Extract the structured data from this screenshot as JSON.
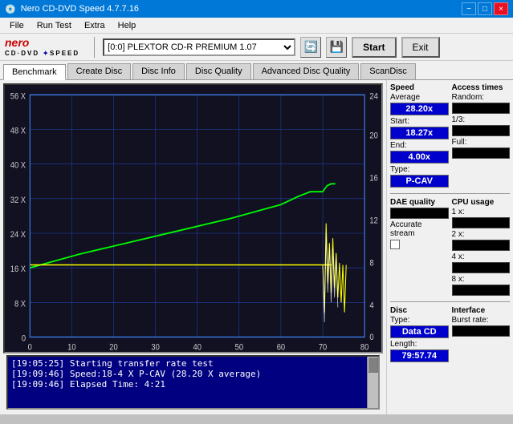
{
  "titleBar": {
    "title": "Nero CD-DVD Speed 4.7.7.16",
    "minimizeLabel": "−",
    "maximizeLabel": "□",
    "closeLabel": "×"
  },
  "menu": {
    "items": [
      "File",
      "Run Test",
      "Extra",
      "Help"
    ]
  },
  "toolbar": {
    "driveValue": "[0:0]  PLEXTOR CD-R  PREMIUM 1.07",
    "startLabel": "Start",
    "exitLabel": "Exit"
  },
  "tabs": {
    "items": [
      "Benchmark",
      "Create Disc",
      "Disc Info",
      "Disc Quality",
      "Advanced Disc Quality",
      "ScanDisc"
    ],
    "active": 0
  },
  "speedPanel": {
    "speedLabel": "Speed",
    "averageLabel": "Average",
    "averageValue": "28.20x",
    "startLabel": "Start:",
    "startValue": "18.27x",
    "endLabel": "End:",
    "endValue": "4.00x",
    "typeLabel": "Type:",
    "typeValue": "P-CAV"
  },
  "accessPanel": {
    "title": "Access times",
    "randomLabel": "Random:",
    "oneThirdLabel": "1/3:",
    "fullLabel": "Full:"
  },
  "daePanel": {
    "title": "DAE quality",
    "accurateStreamLabel": "Accurate",
    "streamLabel": "stream"
  },
  "cpuPanel": {
    "title": "CPU usage",
    "1xLabel": "1 x:",
    "2xLabel": "2 x:",
    "4xLabel": "4 x:",
    "8xLabel": "8 x:"
  },
  "discPanel": {
    "discLabel": "Disc",
    "typeLabel": "Type:",
    "typeValue": "Data CD",
    "lengthLabel": "Length:",
    "lengthValue": "79:57.74",
    "interfaceLabel": "Interface",
    "burstLabel": "Burst rate:"
  },
  "chart": {
    "yAxisLeft": [
      "56 X",
      "48 X",
      "40 X",
      "32 X",
      "24 X",
      "16 X",
      "8 X",
      "0"
    ],
    "yAxisRight": [
      "24",
      "20",
      "16",
      "12",
      "8",
      "4",
      "0"
    ],
    "xAxis": [
      "0",
      "10",
      "20",
      "30",
      "40",
      "50",
      "60",
      "70",
      "80"
    ]
  },
  "log": {
    "entries": [
      "[19:05:25]  Starting transfer rate test",
      "[19:09:46]  Speed:18-4 X P-CAV (28.20 X average)",
      "[19:09:46]  Elapsed Time: 4:21"
    ]
  }
}
